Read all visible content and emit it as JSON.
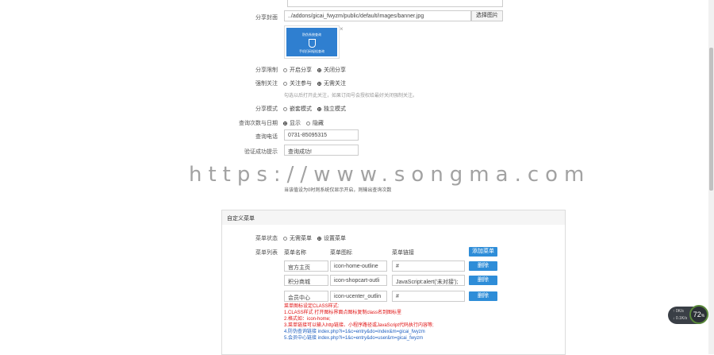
{
  "share_image": {
    "label": "分享封面",
    "path": "../addons/gicai_fwyzm/public/default/images/banner.jpg",
    "select_button": "选择图片",
    "thumb_line1": "防伪系统查询",
    "thumb_line2": "手机扫码轻松查询",
    "remove": "×"
  },
  "share_settings": {
    "label": "分享限制",
    "opt1": "开启分享",
    "opt2": "关闭分享",
    "selected": 2
  },
  "follow": {
    "label": "强制关注",
    "opt1": "关注参与",
    "opt2": "无需关注",
    "selected": 2,
    "hint": "勾选以后打开此关注，如果订阅号会授权给最好关闭强制关注。"
  },
  "share_mode": {
    "label": "分享模式",
    "opt1": "嵌套模式",
    "opt2": "独立模式",
    "selected": 2
  },
  "query_count": {
    "label": "查询次数与日期",
    "opt1": "显示",
    "opt2": "隐藏",
    "selected": 1
  },
  "hotline": {
    "label": "查询电话",
    "value": "0731-85095315"
  },
  "success_tip": {
    "label": "验证成功提示",
    "value": "查询成功!"
  },
  "obscured_hint": "当该值设为0时则系统仅显示开启，则输出查询次数",
  "custom_menu": {
    "section_title": "自定义菜单",
    "status_label": "菜单状态",
    "opt1": "无需菜单",
    "opt2": "设置菜单",
    "selected": 2,
    "list_label": "菜单列表",
    "col_name": "菜单名称",
    "col_icon": "菜单图标",
    "col_link": "菜单链接",
    "add_button": "添加菜单",
    "delete_button": "删除",
    "rows": [
      {
        "name": "官方主页",
        "icon": "icon-home-outline",
        "link": "#"
      },
      {
        "name": "积分商城",
        "icon": "icon-shopcart-outli",
        "link": "JavaScript:alert('未对接');"
      },
      {
        "name": "会员中心",
        "icon": "icon-ucenter_outlin",
        "link": "#"
      }
    ],
    "notes": [
      {
        "text": "菜单图标设定CLASS样式:",
        "color": "red"
      },
      {
        "text": "1.CLASS样式 打开图标界面点图标复制class名到图标里",
        "color": "red"
      },
      {
        "text": "2.格式如：icon-home;",
        "color": "red"
      },
      {
        "text": "3.菜单链接可以输入http链接、小程序路径或JavaScript代码执行内容等;",
        "color": "red"
      },
      {
        "text": "4.防伪查询链接 index.php?i=1&c=entry&do=index&m=gicai_fwyzm",
        "color": "blue"
      },
      {
        "text": "5.会员中心链接 index.php?i=1&c=entry&do=user&m=gicai_fwyzm",
        "color": "blue"
      }
    ]
  },
  "watermark": "https://www.songma.com",
  "speed_widget": {
    "percent": "72",
    "unit": "%",
    "up": "0K/s",
    "down": "0.1K/s"
  }
}
